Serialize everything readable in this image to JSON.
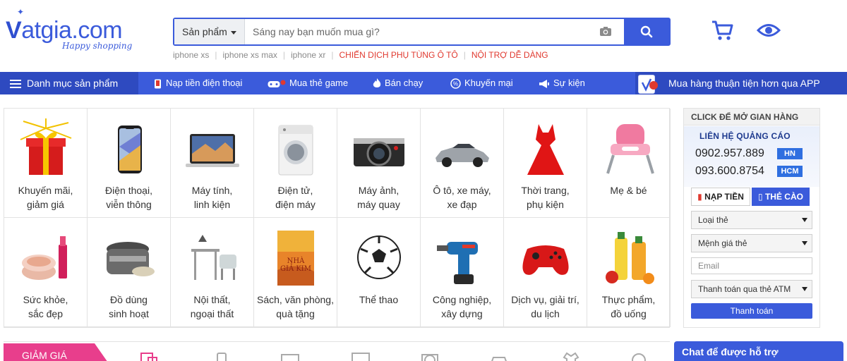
{
  "logo": {
    "main": "atgia.com",
    "v": "V",
    "tagline": "Happy shopping"
  },
  "search": {
    "category": "Sản phẩm",
    "placeholder": "Sáng nay bạn muốn mua gì?",
    "suggestions": [
      {
        "text": "iphone xs",
        "style": "grey"
      },
      {
        "text": "iphone xs max",
        "style": "grey"
      },
      {
        "text": "iphone xr",
        "style": "grey"
      },
      {
        "text": "CHIẾN DỊCH PHỤ TÙNG Ô TÔ",
        "style": "red"
      },
      {
        "text": "NỘI TRỢ DỄ DÀNG",
        "style": "red"
      }
    ]
  },
  "icons": {
    "cart": "cart-icon",
    "eye": "eye-icon",
    "search": "search-icon",
    "camera": "camera-icon"
  },
  "navbar": {
    "menu_label": "Danh mục sản phẩm",
    "items": [
      {
        "label": "Nạp tiền điện thoại",
        "icon": "phone-topup-icon"
      },
      {
        "label": "Mua thẻ game",
        "icon": "gamepad-icon"
      },
      {
        "label": "Bán chạy",
        "icon": "fire-icon"
      },
      {
        "label": "Khuyến mại",
        "icon": "percent-icon"
      },
      {
        "label": "Sự kiện",
        "icon": "megaphone-icon"
      }
    ],
    "app_label": "Mua hàng thuận tiện hơn qua APP"
  },
  "categories": [
    {
      "line1": "Khuyến mãi,",
      "line2": "giảm giá",
      "icon": "gift-icon"
    },
    {
      "line1": "Điện thoại,",
      "line2": "viễn thông",
      "icon": "smartphone-icon"
    },
    {
      "line1": "Máy tính,",
      "line2": "linh kiện",
      "icon": "laptop-icon"
    },
    {
      "line1": "Điện tử,",
      "line2": "điện máy",
      "icon": "washing-machine-icon"
    },
    {
      "line1": "Máy ảnh,",
      "line2": "máy quay",
      "icon": "camera-product-icon"
    },
    {
      "line1": "Ô tô, xe máy,",
      "line2": "xe đạp",
      "icon": "car-icon"
    },
    {
      "line1": "Thời trang,",
      "line2": "phụ kiện",
      "icon": "dress-icon"
    },
    {
      "line1": "Mẹ & bé",
      "line2": "",
      "icon": "baby-chair-icon"
    },
    {
      "line1": "Sức khỏe,",
      "line2": "sắc đẹp",
      "icon": "cosmetics-icon"
    },
    {
      "line1": "Đồ dùng",
      "line2": "sinh hoạt",
      "icon": "rice-cooker-icon"
    },
    {
      "line1": "Nội thất,",
      "line2": "ngoại thất",
      "icon": "furniture-icon"
    },
    {
      "line1": "Sách, văn phòng,",
      "line2": "quà tặng",
      "icon": "book-icon"
    },
    {
      "line1": "Thể thao",
      "line2": "",
      "icon": "football-icon"
    },
    {
      "line1": "Công nghiệp,",
      "line2": "xây dựng",
      "icon": "drill-icon"
    },
    {
      "line1": "Dịch vụ, giải trí,",
      "line2": "du lịch",
      "icon": "game-controller-icon"
    },
    {
      "line1": "Thực phẩm,",
      "line2": "đồ uống",
      "icon": "juice-icon"
    }
  ],
  "book_cover": {
    "line1": "NHÀ",
    "line2": "GIẢ KIM"
  },
  "panel": {
    "title": "CLICK ĐỂ MỞ GIAN HÀNG",
    "ad_head": "LIÊN HỆ QUẢNG CÁO",
    "phones": [
      {
        "number": "0902.957.889",
        "tag": "HN"
      },
      {
        "number": "093.600.8754",
        "tag": "HCM"
      }
    ],
    "tab_nap": "NẠP TIỀN",
    "tab_the": "THẺ CÀO",
    "select_type": "Loại thẻ",
    "select_value": "Mệnh giá thẻ",
    "email_placeholder": "Email",
    "select_pay": "Thanh toán qua thẻ ATM",
    "pay_button": "Thanh toán"
  },
  "bottom": {
    "giam_label": "GIẢM GIÁ",
    "chat_label": "Chat để được hỗ trợ"
  },
  "colors": {
    "brand": "#3b5bdb",
    "brand_dark": "#2e4ac0",
    "red": "#e0392f",
    "pink": "#e83e8c"
  }
}
